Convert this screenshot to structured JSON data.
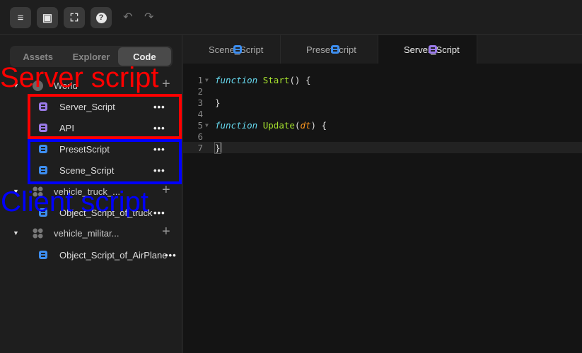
{
  "toolbar": {
    "buttons": [
      {
        "icon": "menu-icon",
        "glyph": "≡"
      },
      {
        "icon": "inbox-icon",
        "glyph": "▣"
      },
      {
        "icon": "add-frame-icon",
        "glyph": "⛶"
      },
      {
        "icon": "help-icon",
        "glyph": "?"
      }
    ],
    "undo": "↶",
    "redo": "↷"
  },
  "sidebar": {
    "tabs": [
      "Assets",
      "Explorer",
      "Code"
    ],
    "active_tab": "Code",
    "tree": {
      "world": {
        "label": "World",
        "children": [
          "Server_Script",
          "API",
          "PresetScript",
          "Scene_Script"
        ]
      },
      "truck": {
        "label": "vehicle_truck_...",
        "child": "Object_Script_of_truck"
      },
      "military": {
        "label": "vehicle_militar...",
        "child": "Object_Script_of_AirPlane"
      }
    },
    "more": "•••",
    "plus": "+"
  },
  "editor": {
    "tabs": [
      "Scene_Script",
      "PresetScript",
      "Server_Script"
    ],
    "active_tab": "Server_Script",
    "code": {
      "kw": "function",
      "start": "Start",
      "start_rest": "() {",
      "close": "}",
      "update": "Update",
      "paren_open": "(",
      "param": "dt",
      "update_rest": ") {"
    }
  },
  "annotations": {
    "server": "Server script",
    "client": "Client script"
  },
  "colors": {
    "server_script": "#9b7bea",
    "client_script": "#3d8ef0",
    "server_annotation": "#ff0000",
    "client_annotation": "#0000ff"
  }
}
